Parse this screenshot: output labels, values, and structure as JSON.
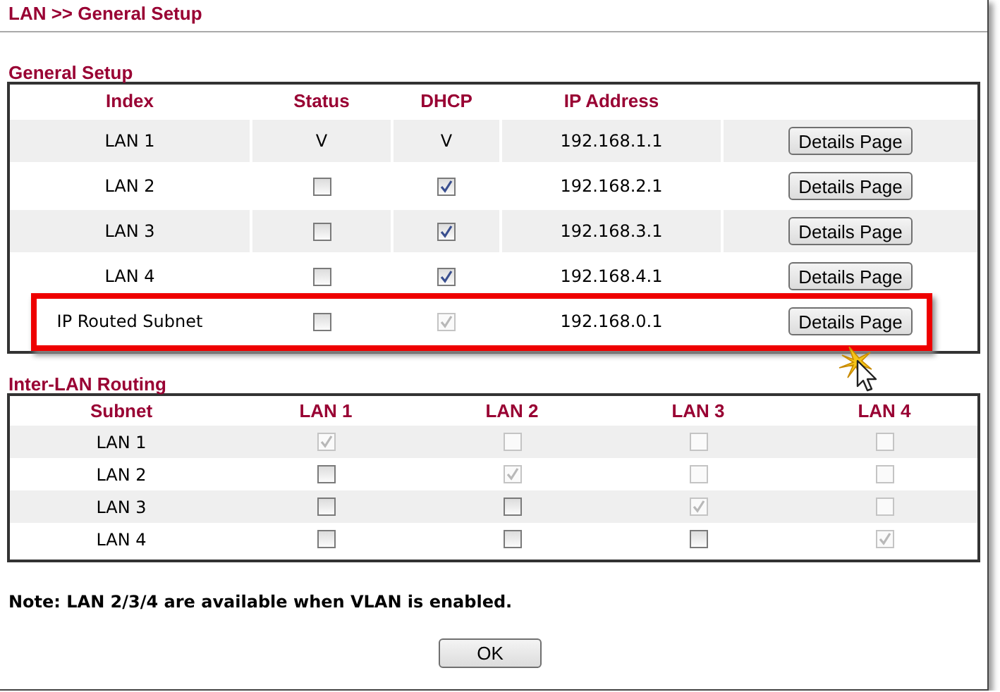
{
  "breadcrumb": "LAN >> General Setup",
  "general_setup": {
    "title": "General Setup",
    "columns": [
      "Index",
      "Status",
      "DHCP",
      "IP Address"
    ],
    "rows": [
      {
        "index": "LAN 1",
        "status": {
          "kind": "text",
          "text": "V"
        },
        "dhcp": {
          "kind": "text",
          "text": "V"
        },
        "ip_address": "192.168.1.1",
        "button": "Details Page",
        "highlighted": false
      },
      {
        "index": "LAN 2",
        "status": {
          "kind": "checkbox",
          "checked": false,
          "disabled": false
        },
        "dhcp": {
          "kind": "checkbox",
          "checked": true,
          "disabled": false
        },
        "ip_address": "192.168.2.1",
        "button": "Details Page",
        "highlighted": false
      },
      {
        "index": "LAN 3",
        "status": {
          "kind": "checkbox",
          "checked": false,
          "disabled": false
        },
        "dhcp": {
          "kind": "checkbox",
          "checked": true,
          "disabled": false
        },
        "ip_address": "192.168.3.1",
        "button": "Details Page",
        "highlighted": false
      },
      {
        "index": "LAN 4",
        "status": {
          "kind": "checkbox",
          "checked": false,
          "disabled": false
        },
        "dhcp": {
          "kind": "checkbox",
          "checked": true,
          "disabled": false
        },
        "ip_address": "192.168.4.1",
        "button": "Details Page",
        "highlighted": false
      },
      {
        "index": "IP Routed Subnet",
        "status": {
          "kind": "checkbox",
          "checked": false,
          "disabled": false
        },
        "dhcp": {
          "kind": "checkbox",
          "checked": true,
          "disabled": true
        },
        "ip_address": "192.168.0.1",
        "button": "Details Page",
        "highlighted": true
      }
    ]
  },
  "inter_lan_routing": {
    "title": "Inter-LAN Routing",
    "columns": [
      "Subnet",
      "LAN 1",
      "LAN 2",
      "LAN 3",
      "LAN 4"
    ],
    "rows": [
      {
        "subnet": "LAN 1",
        "cells": [
          {
            "checked": true,
            "disabled": true
          },
          {
            "checked": false,
            "disabled": true
          },
          {
            "checked": false,
            "disabled": true
          },
          {
            "checked": false,
            "disabled": true
          }
        ]
      },
      {
        "subnet": "LAN 2",
        "cells": [
          {
            "checked": false,
            "disabled": false
          },
          {
            "checked": true,
            "disabled": true
          },
          {
            "checked": false,
            "disabled": true
          },
          {
            "checked": false,
            "disabled": true
          }
        ]
      },
      {
        "subnet": "LAN 3",
        "cells": [
          {
            "checked": false,
            "disabled": false
          },
          {
            "checked": false,
            "disabled": false
          },
          {
            "checked": true,
            "disabled": true
          },
          {
            "checked": false,
            "disabled": true
          }
        ]
      },
      {
        "subnet": "LAN 4",
        "cells": [
          {
            "checked": false,
            "disabled": false
          },
          {
            "checked": false,
            "disabled": false
          },
          {
            "checked": false,
            "disabled": false
          },
          {
            "checked": true,
            "disabled": true
          }
        ]
      }
    ]
  },
  "note": "Note: LAN 2/3/4 are available when VLAN is enabled.",
  "ok_button": "OK"
}
